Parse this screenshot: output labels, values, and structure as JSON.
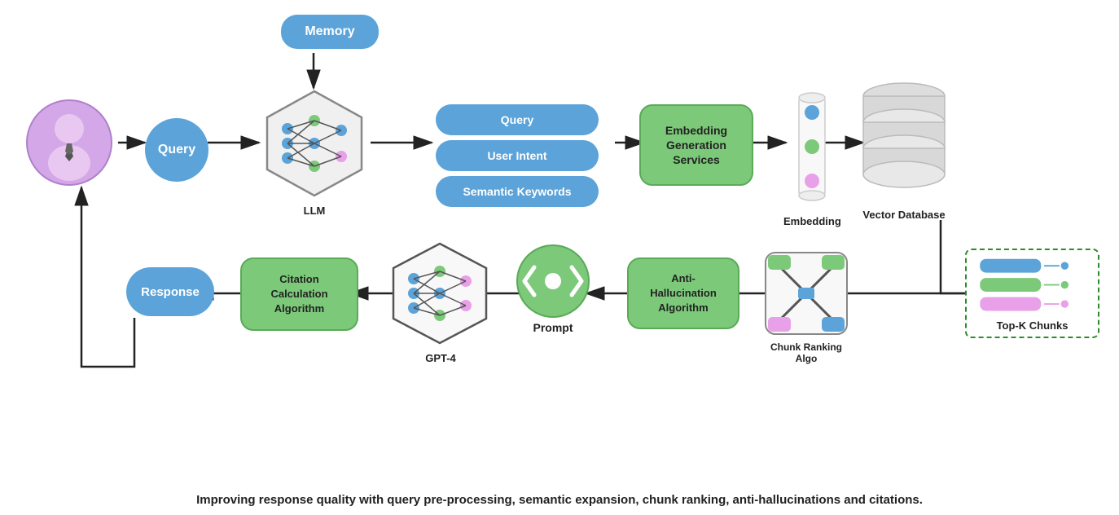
{
  "nodes": {
    "memory": "Memory",
    "query": "Query",
    "llm": "LLM",
    "query_pill": "Query",
    "user_intent_pill": "User Intent",
    "semantic_keywords_pill": "Semantic Keywords",
    "embedding_generation": "Embedding\nGeneration\nServices",
    "embedding_label": "Embedding",
    "vector_database_label": "Vector Database",
    "response": "Response",
    "citation_calculation": "Citation\nCalculation\nAlgorithm",
    "gpt4": "GPT-4",
    "prompt": "Prompt",
    "anti_hallucination": "Anti-\nHallucination\nAlgorithm",
    "chunk_ranking_label": "Chunk\nRanking Algo",
    "topk_label": "Top-K Chunks"
  },
  "caption": "Improving response quality with query pre-processing, semantic expansion, chunk ranking, anti-hallucinations and citations.",
  "colors": {
    "blue": "#5ba3d9",
    "green": "#7dc97a",
    "light_green": "#a8e6a3",
    "pink": "#e8a0e8",
    "arrow": "#222",
    "green_border": "#2d8a2d"
  }
}
